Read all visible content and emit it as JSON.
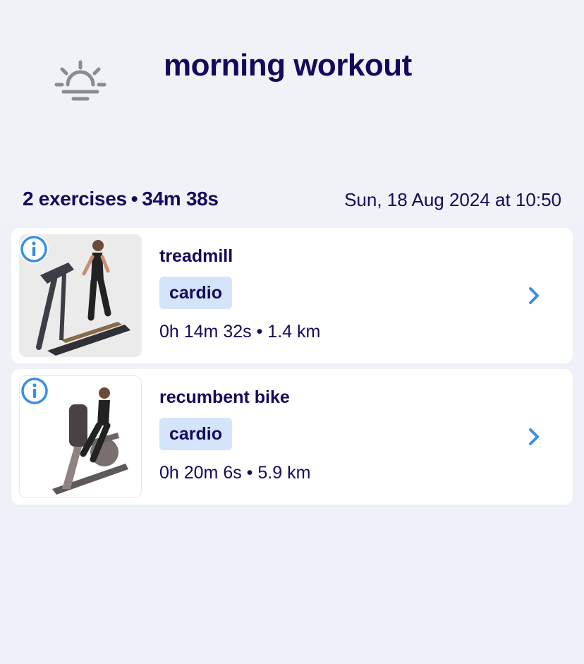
{
  "workout": {
    "title": "morning workout",
    "exercise_count": "2 exercises",
    "duration": "34m 38s",
    "datetime": "Sun, 18 Aug 2024 at 10:50"
  },
  "exercises": [
    {
      "name": "treadmill",
      "tag": "cardio",
      "stats": "0h 14m 32s • 1.4 km"
    },
    {
      "name": "recumbent bike",
      "tag": "cardio",
      "stats": "0h 20m 6s • 5.9 km"
    }
  ],
  "colors": {
    "text": "#140a5c",
    "tag_bg": "#d4e4fa",
    "accent": "#3a8ee6",
    "icon_gray": "#8c8c8c"
  },
  "icons": {
    "workout_time": "sunrise-icon",
    "info": "info-icon",
    "open": "chevron-right-icon"
  }
}
